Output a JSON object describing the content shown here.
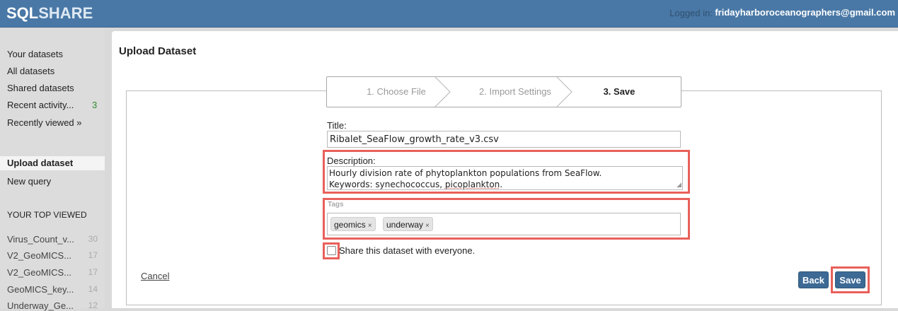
{
  "header": {
    "logo_bold": "SQL",
    "logo_light": "SHARE",
    "logged_in_label": "Logged in:",
    "user_email": "fridayharboroceanographers@gmail.com"
  },
  "sidebar": {
    "nav": [
      {
        "label": "Your datasets"
      },
      {
        "label": "All datasets"
      },
      {
        "label": "Shared datasets"
      },
      {
        "label": "Recent activity...",
        "count": "3"
      },
      {
        "label": "Recently viewed »"
      }
    ],
    "actions": [
      {
        "label": "Upload dataset",
        "active": true
      },
      {
        "label": "New query"
      }
    ],
    "top_viewed_heading": "YOUR TOP VIEWED",
    "top_viewed": [
      {
        "label": "Virus_Count_v...",
        "count": "30"
      },
      {
        "label": "V2_GeoMICS...",
        "count": "17"
      },
      {
        "label": "V2_GeoMICS...",
        "count": "17"
      },
      {
        "label": "GeoMICS_key...",
        "count": "14"
      },
      {
        "label": "Underway_Ge...",
        "count": "12"
      }
    ]
  },
  "main": {
    "title": "Upload Dataset",
    "steps": [
      "1. Choose File",
      "2. Import Settings",
      "3. Save"
    ],
    "current_step": 3,
    "form": {
      "title_label": "Title:",
      "title_value": "Ribalet_SeaFlow_growth_rate_v3.csv",
      "description_label": "Description:",
      "description_line1": "Hourly division rate of phytoplankton populations from SeaFlow.",
      "description_line2_prefix": "Keywords: synechococcus, ",
      "description_line2_flagged": "picoplankton",
      "description_line2_suffix": ".",
      "tags_label": "Tags",
      "tags": [
        "geomics",
        "underway"
      ],
      "tag_remove_glyph": "×",
      "share_label": "Share this dataset with everyone.",
      "share_checked": false,
      "cancel_label": "Cancel",
      "back_label": "Back",
      "save_label": "Save"
    },
    "highlight_color": "#e9605a",
    "accent_color": "#3d6a95"
  }
}
